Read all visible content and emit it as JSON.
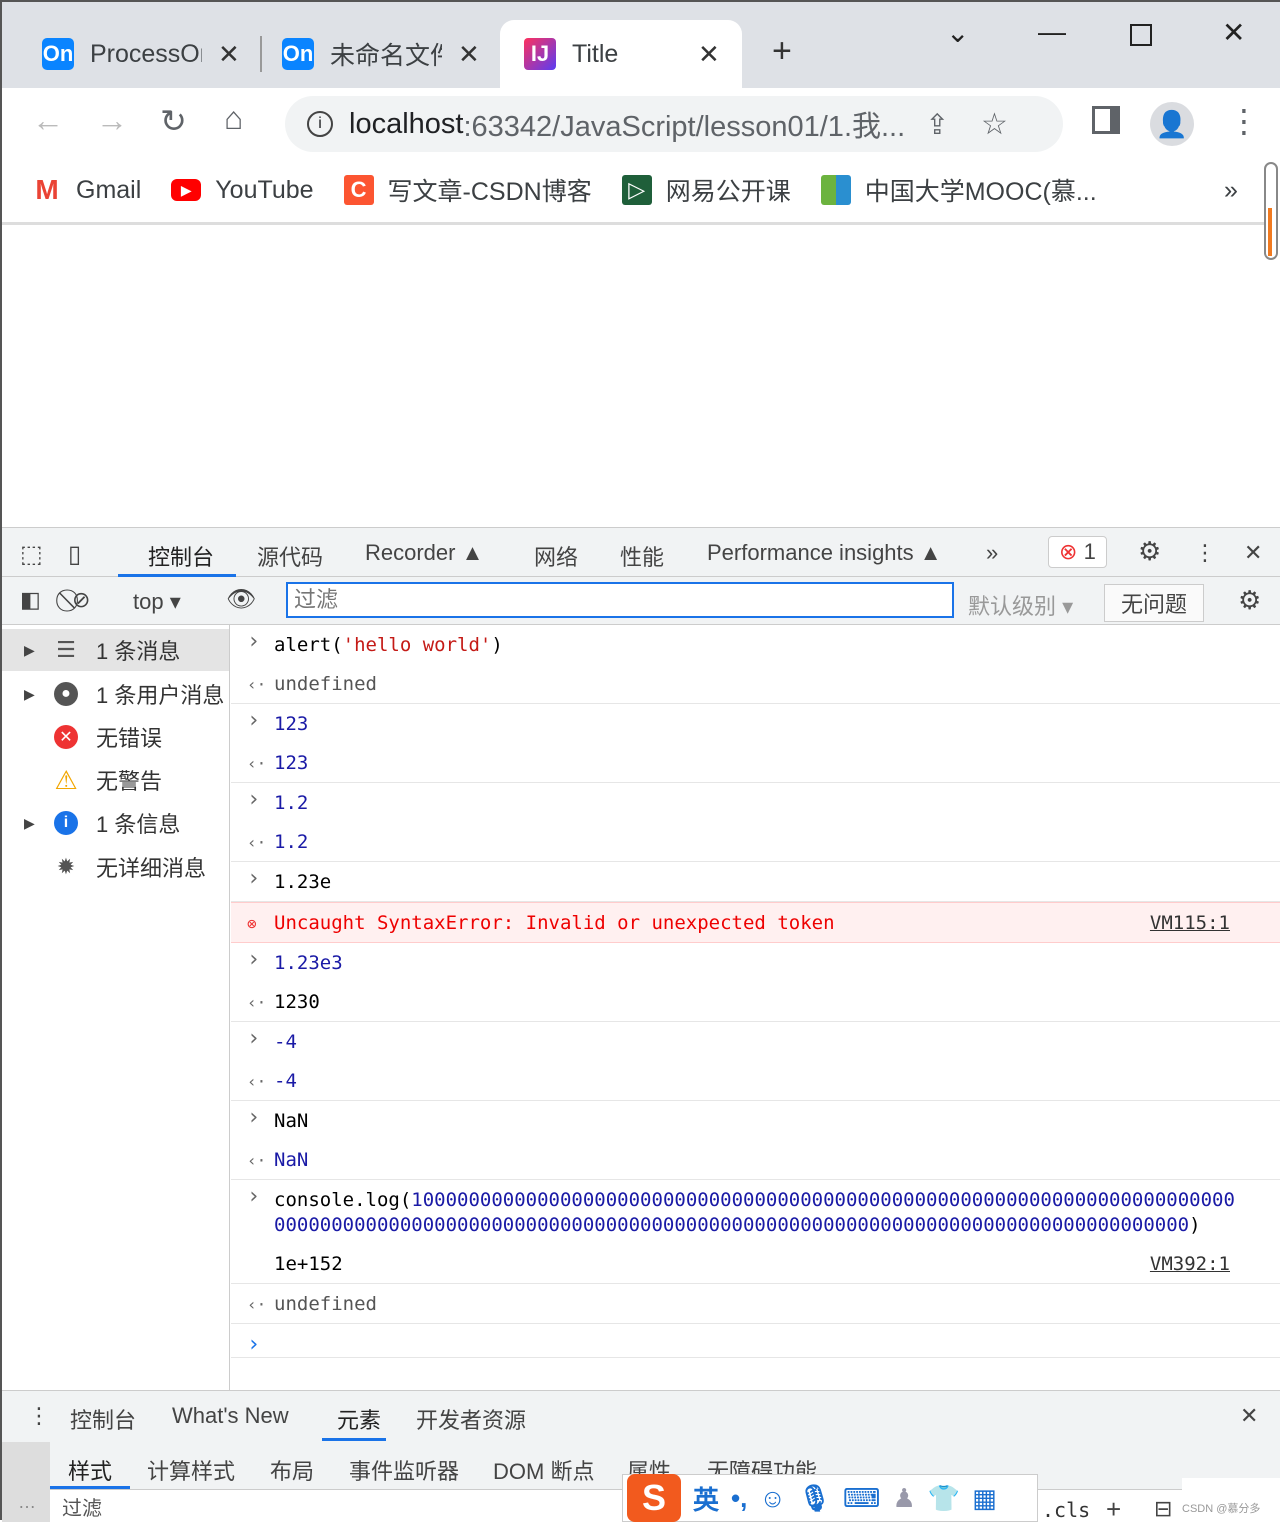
{
  "browser": {
    "tabs": [
      {
        "label": "ProcessOn",
        "favicon": "On"
      },
      {
        "label": "未命名文件",
        "favicon": "On"
      },
      {
        "label": "Title",
        "favicon": "IJ",
        "active": true
      }
    ],
    "url_host": "localhost",
    "url_rest": ":63342/JavaScript/lesson01/1.我...",
    "bookmarks": [
      {
        "label": "Gmail",
        "icon": "M",
        "color": "#ea4335"
      },
      {
        "label": "YouTube",
        "icon": "▶",
        "color": "#ff0000"
      },
      {
        "label": "写文章-CSDN博客",
        "icon": "C",
        "color": "#fc5531"
      },
      {
        "label": "网易公开课",
        "icon": "▷",
        "color": "#1f5f3a"
      },
      {
        "label": "中国大学MOOC(慕...",
        "icon": "▮",
        "color": "#2a8fd0"
      }
    ],
    "more_bookmarks": "»"
  },
  "devtools": {
    "tabs": [
      "控制台",
      "源代码",
      "Recorder ▲",
      "网络",
      "性能",
      "Performance insights ▲"
    ],
    "more": "»",
    "error_count": "1",
    "context": "top",
    "filter_placeholder": "过滤",
    "level": "默认级别 ▾",
    "issues": "无问题",
    "sidebar": [
      {
        "label": "1 条消息",
        "icon": "list-icon"
      },
      {
        "label": "1 条用户消息",
        "icon": "user-icon"
      },
      {
        "label": "无错误",
        "icon": "error-icon"
      },
      {
        "label": "无警告",
        "icon": "warning-icon"
      },
      {
        "label": "1 条信息",
        "icon": "info-icon"
      },
      {
        "label": "无详细消息",
        "icon": "bug-icon"
      }
    ],
    "console": [
      {
        "type": "in",
        "parts": [
          [
            "",
            "alert("
          ],
          [
            "str",
            "'hello world'"
          ],
          [
            "",
            ")"
          ]
        ]
      },
      {
        "type": "out",
        "parts": [
          [
            "gray",
            "undefined"
          ]
        ],
        "sep": true
      },
      {
        "type": "in",
        "parts": [
          [
            "blue",
            "123"
          ]
        ]
      },
      {
        "type": "out",
        "parts": [
          [
            "blue",
            "123"
          ]
        ],
        "sep": true
      },
      {
        "type": "in",
        "parts": [
          [
            "blue",
            "1.2"
          ]
        ]
      },
      {
        "type": "out",
        "parts": [
          [
            "blue",
            "1.2"
          ]
        ],
        "sep": true
      },
      {
        "type": "in",
        "parts": [
          [
            "",
            "1.23e"
          ]
        ]
      },
      {
        "type": "err",
        "parts": [
          [
            "",
            "Uncaught SyntaxError: Invalid or unexpected token"
          ]
        ],
        "src": "VM115:1"
      },
      {
        "type": "in",
        "parts": [
          [
            "blue",
            "1.23e3"
          ]
        ]
      },
      {
        "type": "out",
        "parts": [
          [
            "",
            "1230"
          ]
        ],
        "sep": true
      },
      {
        "type": "in",
        "parts": [
          [
            "blue",
            "-4"
          ]
        ]
      },
      {
        "type": "out",
        "parts": [
          [
            "blue",
            "-4"
          ]
        ],
        "sep": true
      },
      {
        "type": "in",
        "parts": [
          [
            "",
            "NaN"
          ]
        ]
      },
      {
        "type": "out",
        "parts": [
          [
            "blue",
            "NaN"
          ]
        ],
        "sep": true
      },
      {
        "type": "in",
        "parts": [
          [
            "",
            "console.log("
          ],
          [
            "blue",
            "10000000000000000000000000000000000000000000000000000000000000000000000000000000000000000000000000000000000000000000000000000000000000000000000000000000"
          ],
          [
            "",
            ")"
          ]
        ]
      },
      {
        "type": "log",
        "parts": [
          [
            "",
            "1e+152"
          ]
        ],
        "src": "VM392:1"
      },
      {
        "type": "out",
        "parts": [
          [
            "gray",
            "undefined"
          ]
        ],
        "sep": true
      },
      {
        "type": "prompt",
        "parts": []
      }
    ],
    "drawer_tabs": [
      "控制台",
      "What's New",
      "元素",
      "开发者资源"
    ],
    "sub_tabs": [
      "样式",
      "计算样式",
      "布局",
      "事件监听器",
      "DOM 断点",
      "属性",
      "无障碍功能"
    ],
    "styles_filter": "过滤",
    "cls": ".cls"
  },
  "ime": {
    "mode": "英",
    "punct": "•,"
  },
  "watermark": "CSDN @慕分多"
}
